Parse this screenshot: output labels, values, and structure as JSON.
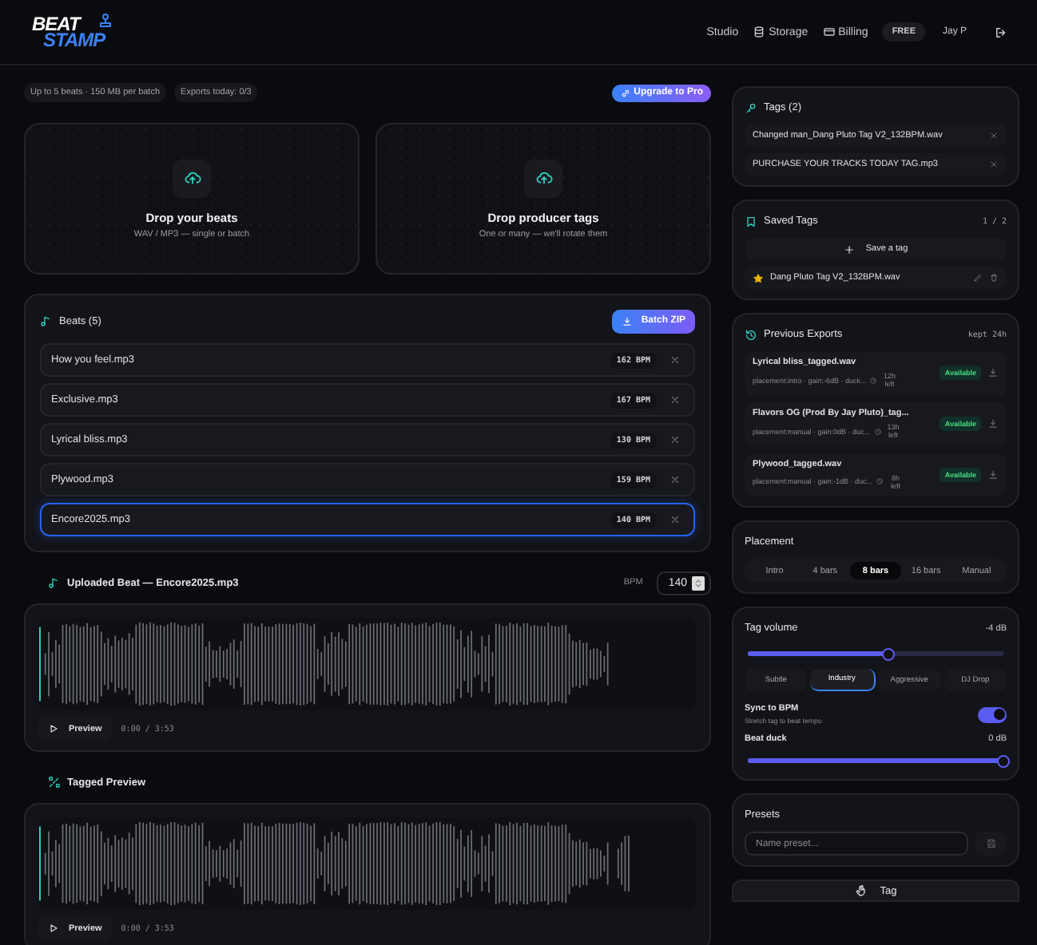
{
  "header": {
    "logo": {
      "top": "BEAT",
      "bottom": "STAMP"
    },
    "nav": [
      {
        "label": "Studio"
      },
      {
        "label": "Storage"
      },
      {
        "label": "Billing"
      }
    ],
    "plan": "FREE",
    "user": "Jay P"
  },
  "limits": [
    "Up to 5 beats · 150 MB per batch",
    "Exports today: 0/3"
  ],
  "upgrade_button": "Upgrade to Pro",
  "dropzones": [
    {
      "title": "Drop your beats",
      "subtitle": "WAV / MP3 — single or batch"
    },
    {
      "title": "Drop producer tags",
      "subtitle": "One or many — we'll rotate them"
    }
  ],
  "beats": {
    "title": "Beats (5)",
    "batch_button": "Batch ZIP",
    "items": [
      {
        "name": "How you feel.mp3",
        "bpm": "162 BPM",
        "selected": false
      },
      {
        "name": "Exclusive.mp3",
        "bpm": "167 BPM",
        "selected": false
      },
      {
        "name": "Lyrical bliss.mp3",
        "bpm": "130 BPM",
        "selected": false
      },
      {
        "name": "Plywood.mp3",
        "bpm": "159 BPM",
        "selected": false
      },
      {
        "name": "Encore2025.mp3",
        "bpm": "140 BPM",
        "selected": true
      }
    ]
  },
  "uploaded": {
    "title": "Uploaded Beat — Encore2025.mp3",
    "bpm_label": "BPM",
    "bpm_value": "140",
    "preview_button": "Preview",
    "time": "0:00 / 3:53"
  },
  "tagged": {
    "title": "Tagged Preview",
    "preview_button": "Preview",
    "time": "0:00 / 3:53"
  },
  "tags": {
    "title": "Tags (2)",
    "items": [
      {
        "name": "Changed man_Dang Pluto Tag V2_132BPM.wav"
      },
      {
        "name": "PURCHASE YOUR TRACKS TODAY TAG.mp3"
      }
    ]
  },
  "saved_tags": {
    "title": "Saved Tags",
    "count": "1 / 2",
    "save_button": "Save a tag",
    "items": [
      {
        "name": "Dang Pluto Tag V2_132BPM.wav",
        "starred": true
      }
    ]
  },
  "exports": {
    "title": "Previous Exports",
    "retention": "kept 24h",
    "items": [
      {
        "name": "Lyrical bliss_tagged.wav",
        "meta": "placement:intro · gain:-6dB · duck...",
        "remaining": "12h left",
        "status": "Available"
      },
      {
        "name": "Flavors OG (Prod By Jay Pluto)_tag...",
        "meta": "placement:manual · gain:0dB · duc...",
        "remaining": "13h left",
        "status": "Available"
      },
      {
        "name": "Plywood_tagged.wav",
        "meta": "placement:manual · gain:-1dB · duc...",
        "remaining": "8h left",
        "status": "Available"
      }
    ]
  },
  "placement": {
    "title": "Placement",
    "options": [
      {
        "label": "Intro",
        "selected": false
      },
      {
        "label": "4 bars",
        "selected": false
      },
      {
        "label": "8 bars",
        "selected": true
      },
      {
        "label": "16 bars",
        "selected": false
      },
      {
        "label": "Manual",
        "selected": false
      }
    ]
  },
  "volume": {
    "title": "Tag volume",
    "reading": "-4 dB",
    "level": 0.55,
    "presets": [
      {
        "label": "Subtle",
        "selected": false
      },
      {
        "label": "Industry",
        "selected": true
      },
      {
        "label": "Aggressive",
        "selected": false
      },
      {
        "label": "DJ Drop",
        "selected": false
      }
    ],
    "sync": {
      "title": "Sync to BPM",
      "subtitle": "Stretch tag to beat tempo",
      "on": true
    },
    "duck": {
      "title": "Beat duck",
      "reading": "0 dB",
      "level": 1.0
    }
  },
  "presets": {
    "title": "Presets",
    "placeholder": "Name preset..."
  },
  "tag_button": "Tag"
}
